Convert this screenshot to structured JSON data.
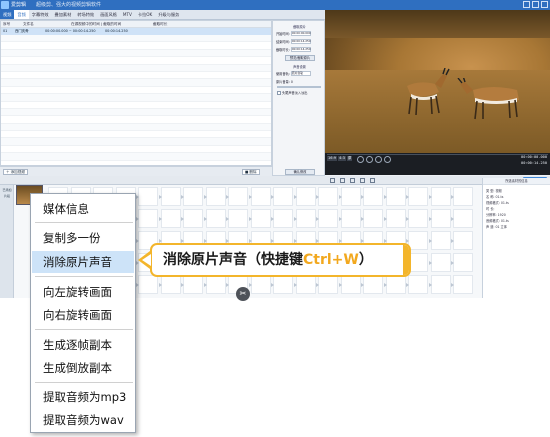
{
  "app": {
    "title": "爱剪辑",
    "subtitle": "超级剪、强大的视频剪辑软件"
  },
  "tabs": [
    "视频",
    "音频",
    "字幕特效",
    "叠加素材",
    "转场特效",
    "画面风格",
    "MTV",
    "卡拉OK",
    "升级与服务"
  ],
  "file_list": {
    "headers": [
      "序号",
      "文件名",
      "在源视频中的时间 | 截取的时间",
      "截取时长"
    ],
    "selected_row": {
      "index": "01",
      "name": "西门庆骨",
      "range": "00:00:00.000 ~ 00:00:14.250",
      "duration": "00:00:14.250"
    }
  },
  "clip_panel": {
    "section_clip": "截取原片",
    "start_label": "开始时间:",
    "end_label": "结束时间:",
    "duration_label": "截取时长:",
    "start_value": "00:00:00.000",
    "end_value": "00:00:14.250",
    "duration_value": "00:00:14.250",
    "preview_button": "预览/截取原片",
    "section_audio": "声音设置",
    "track_label": "使用音轨:",
    "track_value": "原片音轨",
    "volume_label": "原片音量:",
    "volume_value": "0",
    "mute_label": "头尾声音淡入淡出",
    "confirm_button": "确认修改"
  },
  "player": {
    "ratio_buttons": [
      "16:9",
      "4:3",
      "原"
    ],
    "time_current": "00:00:00.000",
    "time_total": "00:00:14.250",
    "progress": 0
  },
  "buttons": {
    "add_video": "添加视频",
    "delete": "删除",
    "export": "导出视频"
  },
  "track": {
    "labels": [
      "已添加片段"
    ]
  },
  "info_panel": {
    "title": "所选素材的信息",
    "lines": [
      "类 型: 视频",
      "名 称: 01.ts",
      "视频格式: 01.ts",
      "时 长: ",
      "分辨率: 1920",
      "音频格式: 01.ts",
      "声 道: 01 立体"
    ]
  },
  "context_menu": {
    "items": [
      "媒体信息",
      "复制多一份",
      "消除原片声音",
      "向左旋转画面",
      "向右旋转画面",
      "生成逐帧副本",
      "生成倒放副本",
      "提取音频为mp3",
      "提取音频为wav"
    ],
    "highlighted": "消除原片声音"
  },
  "callout": {
    "text": "消除原片声音（快捷键",
    "shortcut": "Ctrl+W",
    "close": "）"
  }
}
